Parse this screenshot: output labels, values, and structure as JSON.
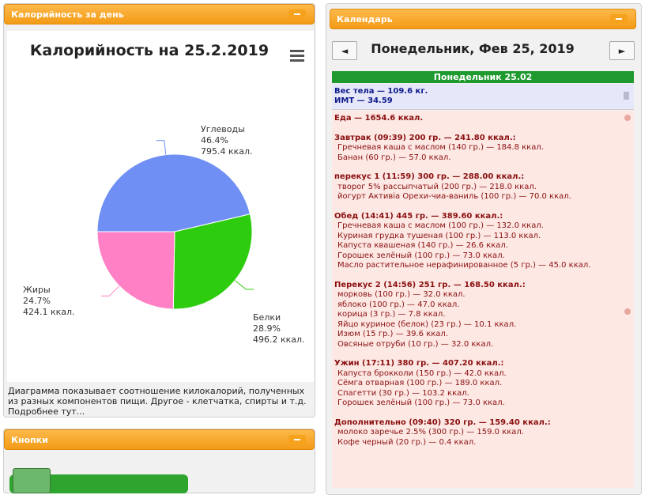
{
  "left_panel": {
    "title": "Калорийность за день",
    "chart_data": {
      "type": "pie",
      "title": "Калорийность на 25.2.2019",
      "slices": [
        {
          "name": "Углеводы",
          "percent": "46.4%",
          "kcal": "795.4 ккал.",
          "value": 795.4,
          "color": "#6f8ff5"
        },
        {
          "name": "Белки",
          "percent": "28.9%",
          "kcal": "496.2 ккал.",
          "value": 496.2,
          "color": "#2ecc0e"
        },
        {
          "name": "Жиры",
          "percent": "24.7%",
          "kcal": "424.1 ккал.",
          "value": 424.1,
          "color": "#ff80c4"
        }
      ]
    },
    "description": "Диаграмма показывает соотношение килокалорий, полученных из разных компонентов пищи. Другое - клетчатка, спирты и т.д. Подробнее тут..."
  },
  "buttons_panel": {
    "title": "Кнопки"
  },
  "calendar": {
    "title": "Календарь",
    "prev_label": "◄",
    "next_label": "►",
    "date_title": "Понедельник, Фев 25, 2019",
    "day_header": "Понедельник 25.02",
    "weight": "Вес тела — 109.6 кг.",
    "bmi": "ИМТ — 34.59",
    "food_total": "Еда — 1654.6 ккал.",
    "meals": [
      {
        "title": "Завтрак (09:39) 200 гр. — 241.80 ккал.:",
        "items": [
          "Гречневая каша с маслом (140 гр.) — 184.8 ккал.",
          "Банан (60 гр.) — 57.0 ккал."
        ]
      },
      {
        "title": "перекус 1 (11:59) 300 гр. — 288.00 ккал.:",
        "items": [
          "творог 5% рассыпчатый (200 гр.) — 218.0 ккал.",
          "йогурт Активia Орехи-чиа-ваниль (100 гр.) — 70.0 ккал."
        ]
      },
      {
        "title": "Обед (14:41) 445 гр. — 389.60 ккал.:",
        "items": [
          "Гречневая каша с маслом (100 гр.) — 132.0 ккал.",
          "Куриная грудка тушеная (100 гр.) — 113.0 ккал.",
          "Капуста квашеная (140 гр.) — 26.6 ккал.",
          "Горошек зелёный (100 гр.) — 73.0 ккал.",
          "Масло растительное нерафинированное (5 гр.) — 45.0 ккал."
        ]
      },
      {
        "title": "Перекус 2 (14:56) 251 гр. — 168.50 ккал.:",
        "items": [
          "морковь (100 гр.) — 32.0 ккал.",
          "яблоко (100 гр.) — 47.0 ккал.",
          "корица (3 гр.) — 7.8 ккал.",
          "Яйцо куриное (белок) (23 гр.) — 10.1 ккал.",
          "Изюм (15 гр.) — 39.6 ккал.",
          "Овсяные отруби (10 гр.) — 32.0 ккал."
        ]
      },
      {
        "title": "Ужин (17:11) 380 гр. — 407.20 ккал.:",
        "items": [
          "Капуста брокколи (150 гр.) — 42.0 ккал.",
          "Сёмга отварная (100 гр.) — 189.0 ккал.",
          "Спагетти (30 гр.) — 103.2 ккал.",
          "Горошек зелёный (100 гр.) — 73.0 ккал."
        ]
      },
      {
        "title": "Дополнительно (09:40) 320 гр. — 159.40 ккал.:",
        "items": [
          "молоко заречье 2.5% (300 гр.) — 159.0 ккал.",
          "Кофе черный (20 гр.) — 0.4 ккал."
        ]
      }
    ]
  }
}
